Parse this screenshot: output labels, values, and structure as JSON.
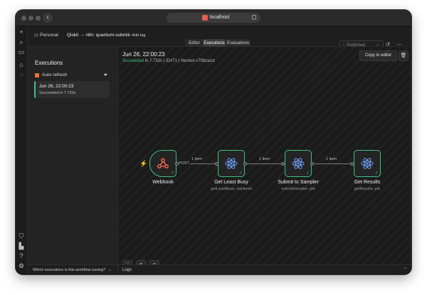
{
  "browser": {
    "url": "localhost"
  },
  "header": {
    "project": "Personal",
    "breadcrumb": "Qiskit → n8n: quantum-submit",
    "add_tag": "+ Add tag",
    "published": "Published",
    "tabs": [
      "Editor",
      "Executions",
      "Evaluations"
    ],
    "active_tab": "Executions"
  },
  "sidebar": {
    "title": "Executions",
    "auto_refresh": "Auto refresh",
    "item": {
      "date": "Jun 26, 22:00:23",
      "status": "Succeeded in 7.732s"
    },
    "footer": "Which executions is this workflow saving?"
  },
  "execution": {
    "date": "Jun 26, 22:00:23",
    "status_word": "Succeeded",
    "meta_rest": " in 7.732s | ID#71 | Version c70bca1d",
    "copy_label": "Copy to editor"
  },
  "workflow": {
    "nodes": [
      {
        "name": "Webhook",
        "sub": "",
        "icon": "webhook-icon"
      },
      {
        "name": "Get Least Busy",
        "sub": "getLeastBusy: backend",
        "icon": "react-icon"
      },
      {
        "name": "Submit to Sampler",
        "sub": "submitSampler: job",
        "icon": "react-icon"
      },
      {
        "name": "Get Results",
        "sub": "getResults: job",
        "icon": "react-icon"
      }
    ],
    "edges": [
      "POST",
      "1 item",
      "1 item",
      "1 item"
    ]
  },
  "logs": {
    "label": "Logs"
  },
  "colors": {
    "success": "#3fbf7f",
    "accent": "#e5624f",
    "bg": "#1b1b1b"
  }
}
